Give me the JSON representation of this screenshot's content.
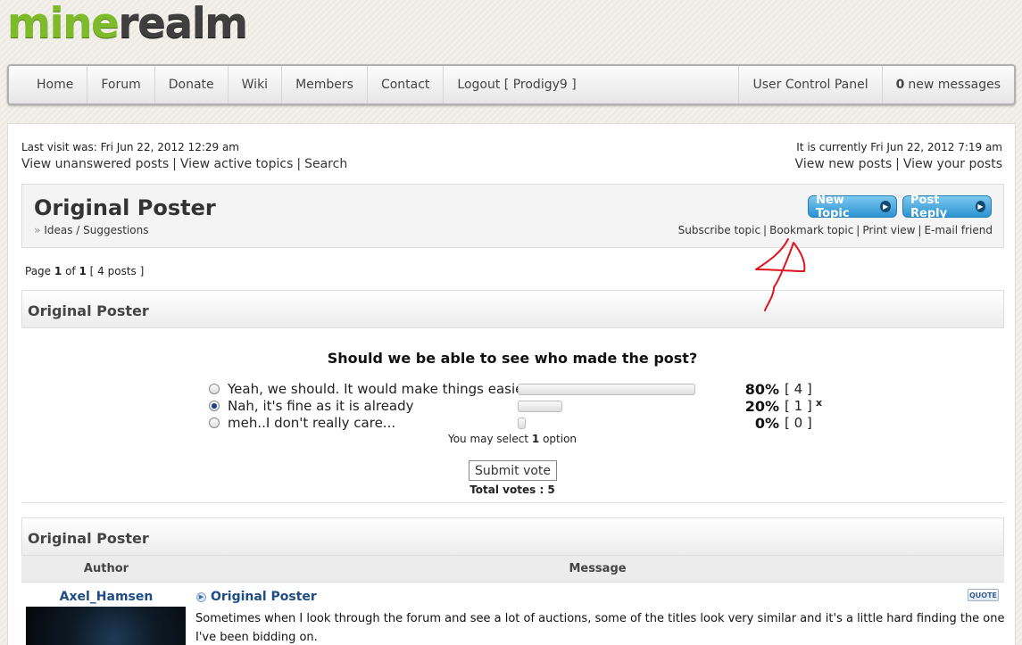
{
  "logo": {
    "part1": "mine",
    "part2": "realm"
  },
  "nav": {
    "left": [
      "Home",
      "Forum",
      "Donate",
      "Wiki",
      "Members",
      "Contact",
      "Logout [ Prodigy9 ]"
    ],
    "ucp": "User Control Panel",
    "messages_count": "0",
    "messages_label": "new messages"
  },
  "info": {
    "last_visit": "Last visit was: Fri Jun 22, 2012 12:29 am",
    "current_time": "It is currently Fri Jun 22, 2012 7:19 am",
    "quick_left": [
      "View unanswered posts",
      "View active topics",
      "Search"
    ],
    "quick_right": [
      "View new posts",
      "View your posts"
    ]
  },
  "topic": {
    "title": "Original Poster",
    "breadcrumb": "Ideas / Suggestions",
    "new_topic": "New Topic",
    "post_reply": "Post Reply",
    "actions": [
      "Subscribe topic",
      "Bookmark topic",
      "Print view",
      "E-mail friend"
    ]
  },
  "pagination": {
    "prefix": "Page",
    "current": "1",
    "of": "of",
    "total": "1",
    "posts": "[ 4 posts ]"
  },
  "poll": {
    "section_title": "Original Poster",
    "question": "Should we be able to see who made the post?",
    "options": [
      {
        "label": "Yeah, we should. It would make things easier",
        "percent": 80,
        "percent_text": "80%",
        "count": "[ 4 ]",
        "selected": false,
        "marker": ""
      },
      {
        "label": "Nah, it's fine as it is already",
        "percent": 20,
        "percent_text": "20%",
        "count": "[ 1 ]",
        "selected": true,
        "marker": "x"
      },
      {
        "label": "meh..I don't really care...",
        "percent": 0,
        "percent_text": "0%",
        "count": "[ 0 ]",
        "selected": false,
        "marker": ""
      }
    ],
    "may_select_prefix": "You may select",
    "may_select_count": "1",
    "may_select_suffix": "option",
    "submit": "Submit vote",
    "total_votes": "Total votes : 5"
  },
  "post": {
    "section_title": "Original Poster",
    "col_author": "Author",
    "col_message": "Message",
    "author_name": "Axel_Hamsen",
    "title": "Original Poster",
    "quote": "QUOTE",
    "body": "Sometimes when I look through the forum and see a lot of auctions, some of the titles look very similar and it's a little hard finding the one I've been bidding on."
  },
  "colors": {
    "link": "#1e4c86",
    "button": "#2c93d2",
    "annotation": "#e0141e"
  }
}
